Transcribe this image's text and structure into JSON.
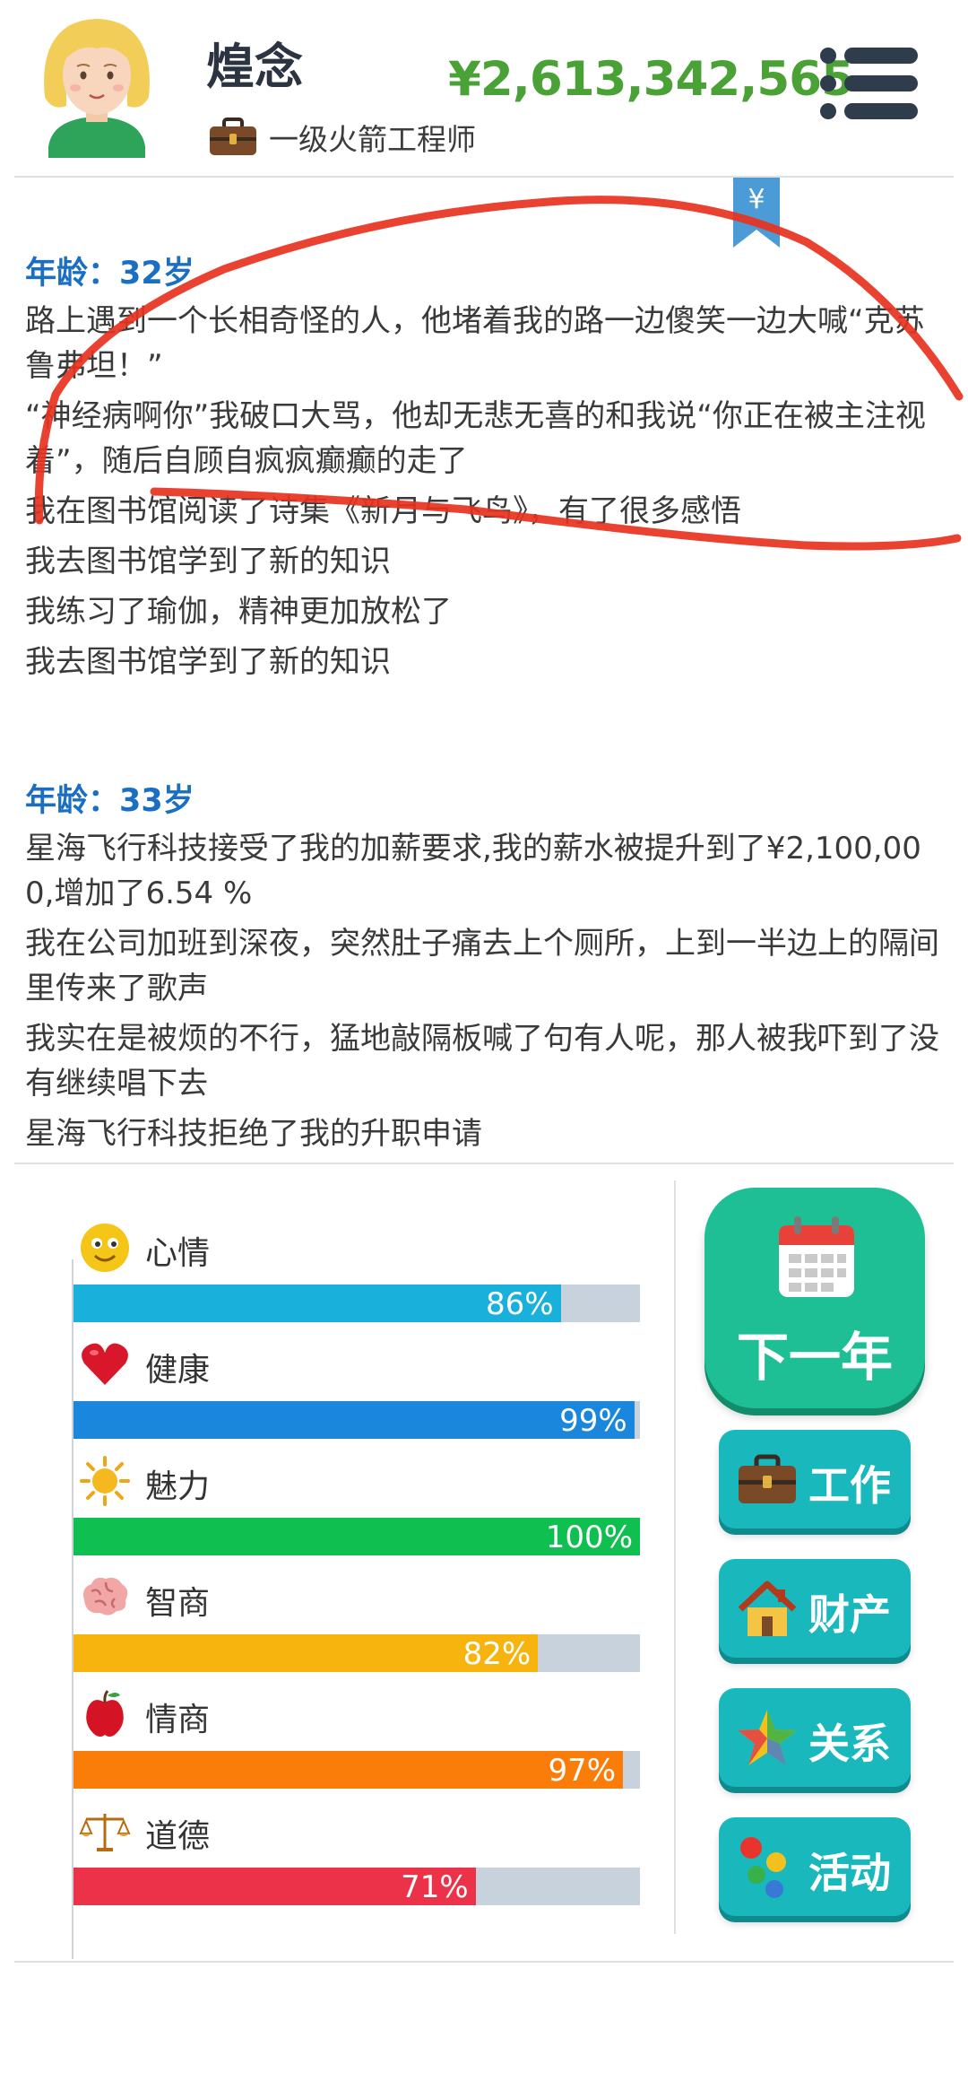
{
  "header": {
    "player_name": "煌念",
    "job_title": "一级火箭工程师",
    "money": "¥2,613,342,565"
  },
  "log": {
    "ribbon_symbol": "¥",
    "blocks": [
      {
        "age": "年龄：32岁",
        "events": [
          "路上遇到一个长相奇怪的人，他堵着我的路一边傻笑一边大喊“克苏鲁弗坦！”",
          "“神经病啊你”我破口大骂，他却无悲无喜的和我说“你正在被主注视着”，随后自顾自疯疯癫癫的走了",
          "我在图书馆阅读了诗集《新月与飞鸟》，有了很多感悟",
          "我去图书馆学到了新的知识",
          "我练习了瑜伽，精神更加放松了",
          "我去图书馆学到了新的知识"
        ]
      },
      {
        "age": "年龄：33岁",
        "events": [
          "星海飞行科技接受了我的加薪要求,我的薪水被提升到了¥2,100,000,增加了6.54 %",
          "我在公司加班到深夜，突然肚子痛去上个厕所，上到一半边上的隔间里传来了歌声",
          "我实在是被烦的不行，猛地敲隔板喊了句有人呢，那人被我吓到了没有继续唱下去",
          "星海飞行科技拒绝了我的升职申请"
        ]
      }
    ]
  },
  "stats": [
    {
      "label": "心情",
      "value": 86,
      "value_text": "86%",
      "color": "#1ab0dc",
      "icon": "smiley-icon"
    },
    {
      "label": "健康",
      "value": 99,
      "value_text": "99%",
      "color": "#1a86dc",
      "icon": "heart-icon"
    },
    {
      "label": "魅力",
      "value": 100,
      "value_text": "100%",
      "color": "#0fbf4f",
      "icon": "sun-icon"
    },
    {
      "label": "智商",
      "value": 82,
      "value_text": "82%",
      "color": "#f7b40e",
      "icon": "brain-icon"
    },
    {
      "label": "情商",
      "value": 97,
      "value_text": "97%",
      "color": "#fb7d09",
      "icon": "apple-icon"
    },
    {
      "label": "道德",
      "value": 71,
      "value_text": "71%",
      "color": "#ec3249",
      "icon": "scales-icon"
    }
  ],
  "actions": {
    "next_year": "下一年",
    "work": "工作",
    "property": "财产",
    "relations": "关系",
    "activities": "活动"
  },
  "colors": {
    "money": "#4aa135",
    "age_heading": "#1b6fc2",
    "next_year_button": "#1ebf94",
    "action_button": "#18b8bd",
    "scribble": "#e8321e"
  }
}
